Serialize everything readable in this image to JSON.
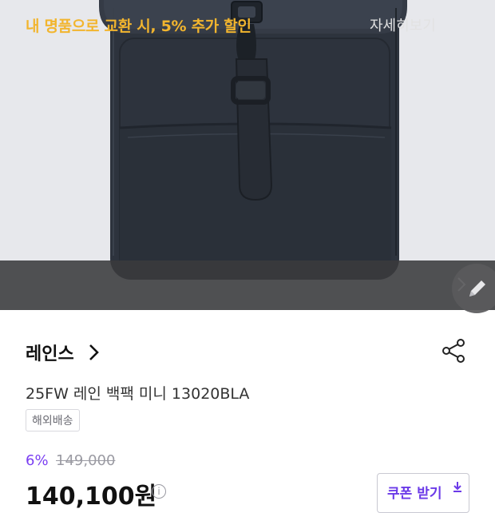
{
  "hero": {
    "image_alt": "product-backpack-image"
  },
  "promo": {
    "text": "내 명품으로 교환 시, 5% 추가 할인",
    "more_label": "자세히보기",
    "color_accent": "#f2b52e"
  },
  "product": {
    "brand": "레인스",
    "title": "25FW 레인 백팩 미니 13020BLA",
    "tag": "해외배송",
    "discount": "6%",
    "original_price": "149,000",
    "price": "140,100원",
    "coupon_label": "쿠폰 받기"
  },
  "colors": {
    "discount": "#7b3ff2",
    "coupon": "#6b3ae8"
  },
  "icons": {
    "edit": "pencil-icon",
    "share": "share-icon",
    "brand_chevron": "chevron-right-icon",
    "info": "info-icon",
    "download": "download-icon"
  }
}
